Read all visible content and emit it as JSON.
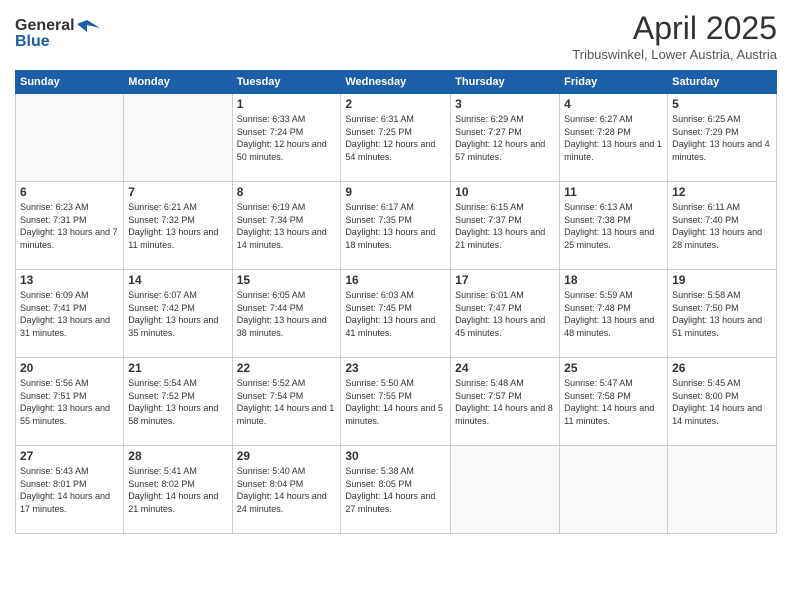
{
  "logo": {
    "general": "General",
    "blue": "Blue"
  },
  "header": {
    "month": "April 2025",
    "location": "Tribuswinkel, Lower Austria, Austria"
  },
  "weekdays": [
    "Sunday",
    "Monday",
    "Tuesday",
    "Wednesday",
    "Thursday",
    "Friday",
    "Saturday"
  ],
  "weeks": [
    [
      {
        "day": "",
        "empty": true
      },
      {
        "day": "",
        "empty": true
      },
      {
        "day": "1",
        "sunrise": "6:33 AM",
        "sunset": "7:24 PM",
        "daylight": "12 hours and 50 minutes."
      },
      {
        "day": "2",
        "sunrise": "6:31 AM",
        "sunset": "7:25 PM",
        "daylight": "12 hours and 54 minutes."
      },
      {
        "day": "3",
        "sunrise": "6:29 AM",
        "sunset": "7:27 PM",
        "daylight": "12 hours and 57 minutes."
      },
      {
        "day": "4",
        "sunrise": "6:27 AM",
        "sunset": "7:28 PM",
        "daylight": "13 hours and 1 minute."
      },
      {
        "day": "5",
        "sunrise": "6:25 AM",
        "sunset": "7:29 PM",
        "daylight": "13 hours and 4 minutes."
      }
    ],
    [
      {
        "day": "6",
        "sunrise": "6:23 AM",
        "sunset": "7:31 PM",
        "daylight": "13 hours and 7 minutes."
      },
      {
        "day": "7",
        "sunrise": "6:21 AM",
        "sunset": "7:32 PM",
        "daylight": "13 hours and 11 minutes."
      },
      {
        "day": "8",
        "sunrise": "6:19 AM",
        "sunset": "7:34 PM",
        "daylight": "13 hours and 14 minutes."
      },
      {
        "day": "9",
        "sunrise": "6:17 AM",
        "sunset": "7:35 PM",
        "daylight": "13 hours and 18 minutes."
      },
      {
        "day": "10",
        "sunrise": "6:15 AM",
        "sunset": "7:37 PM",
        "daylight": "13 hours and 21 minutes."
      },
      {
        "day": "11",
        "sunrise": "6:13 AM",
        "sunset": "7:38 PM",
        "daylight": "13 hours and 25 minutes."
      },
      {
        "day": "12",
        "sunrise": "6:11 AM",
        "sunset": "7:40 PM",
        "daylight": "13 hours and 28 minutes."
      }
    ],
    [
      {
        "day": "13",
        "sunrise": "6:09 AM",
        "sunset": "7:41 PM",
        "daylight": "13 hours and 31 minutes."
      },
      {
        "day": "14",
        "sunrise": "6:07 AM",
        "sunset": "7:42 PM",
        "daylight": "13 hours and 35 minutes."
      },
      {
        "day": "15",
        "sunrise": "6:05 AM",
        "sunset": "7:44 PM",
        "daylight": "13 hours and 38 minutes."
      },
      {
        "day": "16",
        "sunrise": "6:03 AM",
        "sunset": "7:45 PM",
        "daylight": "13 hours and 41 minutes."
      },
      {
        "day": "17",
        "sunrise": "6:01 AM",
        "sunset": "7:47 PM",
        "daylight": "13 hours and 45 minutes."
      },
      {
        "day": "18",
        "sunrise": "5:59 AM",
        "sunset": "7:48 PM",
        "daylight": "13 hours and 48 minutes."
      },
      {
        "day": "19",
        "sunrise": "5:58 AM",
        "sunset": "7:50 PM",
        "daylight": "13 hours and 51 minutes."
      }
    ],
    [
      {
        "day": "20",
        "sunrise": "5:56 AM",
        "sunset": "7:51 PM",
        "daylight": "13 hours and 55 minutes."
      },
      {
        "day": "21",
        "sunrise": "5:54 AM",
        "sunset": "7:52 PM",
        "daylight": "13 hours and 58 minutes."
      },
      {
        "day": "22",
        "sunrise": "5:52 AM",
        "sunset": "7:54 PM",
        "daylight": "14 hours and 1 minute."
      },
      {
        "day": "23",
        "sunrise": "5:50 AM",
        "sunset": "7:55 PM",
        "daylight": "14 hours and 5 minutes."
      },
      {
        "day": "24",
        "sunrise": "5:48 AM",
        "sunset": "7:57 PM",
        "daylight": "14 hours and 8 minutes."
      },
      {
        "day": "25",
        "sunrise": "5:47 AM",
        "sunset": "7:58 PM",
        "daylight": "14 hours and 11 minutes."
      },
      {
        "day": "26",
        "sunrise": "5:45 AM",
        "sunset": "8:00 PM",
        "daylight": "14 hours and 14 minutes."
      }
    ],
    [
      {
        "day": "27",
        "sunrise": "5:43 AM",
        "sunset": "8:01 PM",
        "daylight": "14 hours and 17 minutes."
      },
      {
        "day": "28",
        "sunrise": "5:41 AM",
        "sunset": "8:02 PM",
        "daylight": "14 hours and 21 minutes."
      },
      {
        "day": "29",
        "sunrise": "5:40 AM",
        "sunset": "8:04 PM",
        "daylight": "14 hours and 24 minutes."
      },
      {
        "day": "30",
        "sunrise": "5:38 AM",
        "sunset": "8:05 PM",
        "daylight": "14 hours and 27 minutes."
      },
      {
        "day": "",
        "empty": true
      },
      {
        "day": "",
        "empty": true
      },
      {
        "day": "",
        "empty": true
      }
    ]
  ],
  "labels": {
    "sunrise_prefix": "Sunrise: ",
    "sunset_prefix": "Sunset: ",
    "daylight_prefix": "Daylight: "
  }
}
